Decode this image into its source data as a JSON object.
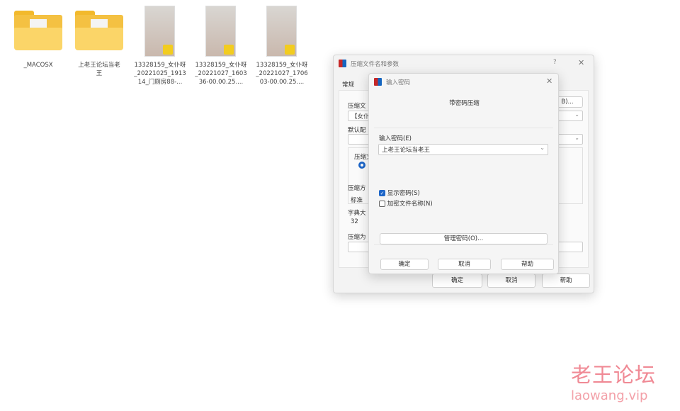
{
  "desktop": {
    "items": [
      {
        "name": "_MACOSX",
        "type": "folder"
      },
      {
        "name": "上老王论坛当老王",
        "type": "folder"
      },
      {
        "name": "13328159_女仆呀_20221025_191314_门厕房88-...",
        "type": "video"
      },
      {
        "name": "13328159_女仆呀_20221027_160336-00.00.25....",
        "type": "video"
      },
      {
        "name": "13328159_女仆呀_20221027_170603-00.00.25....",
        "type": "video"
      }
    ]
  },
  "outer_dialog": {
    "title": "压缩文件名和参数",
    "help": "?",
    "close": "✕",
    "tab": "常规",
    "labels": {
      "archive_name": "压缩文",
      "archive_value": "【女仆",
      "browse": "B)...",
      "profile": "默认配",
      "format": "压缩文",
      "method": "压缩方",
      "method_value": "标准",
      "dict": "字典大",
      "dict_value": "32",
      "split": "压缩为"
    },
    "buttons": {
      "ok": "确定",
      "cancel": "取消",
      "help": "帮助"
    }
  },
  "password_dialog": {
    "title": "输入密码",
    "close": "✕",
    "heading": "带密码压缩",
    "password_label": "输入密码(E)",
    "password_value": "上老王论坛当老王",
    "show_password": {
      "label": "显示密码(S)",
      "checked": true
    },
    "encrypt_names": {
      "label": "加密文件名称(N)",
      "checked": false
    },
    "manage": "管理密码(O)...",
    "buttons": {
      "ok": "确定",
      "cancel": "取消",
      "help": "帮助"
    }
  },
  "watermark": {
    "text": "老王论坛",
    "url": "laowang.vip",
    "color": "#f08a95"
  }
}
